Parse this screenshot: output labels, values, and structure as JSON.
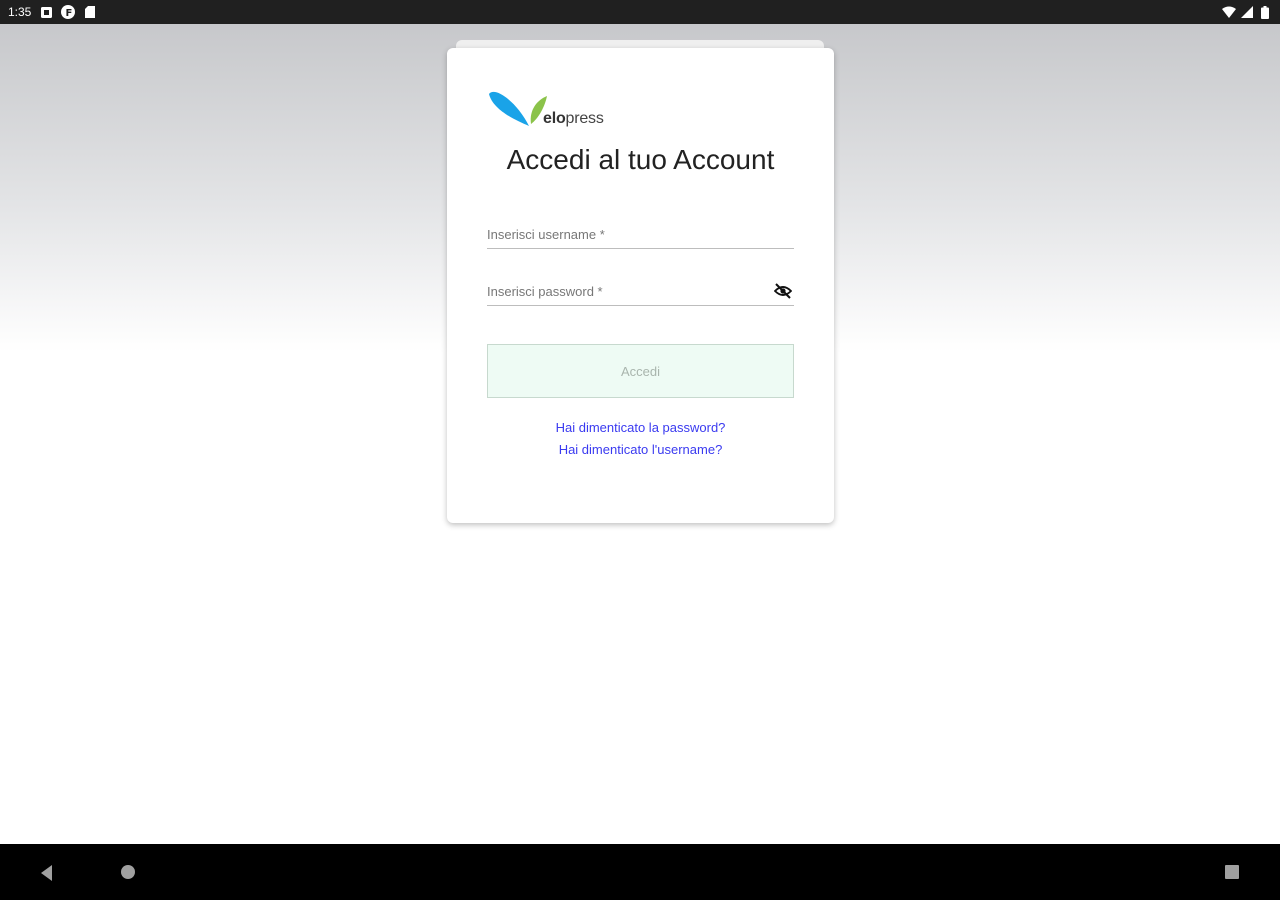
{
  "status_bar": {
    "time": "1:35",
    "icons_left": [
      "notification-icon",
      "app-icon",
      "sd-card-icon"
    ],
    "icons_right": [
      "wifi-icon",
      "signal-icon",
      "battery-icon"
    ]
  },
  "logo": {
    "brand_prefix": "V",
    "brand_bold": "elo",
    "brand_rest": "press",
    "colors": {
      "blue": "#1aa3e8",
      "green": "#8bc34a"
    }
  },
  "login": {
    "title": "Accedi al tuo Account",
    "username_placeholder": "Inserisci username *",
    "password_placeholder": "Inserisci password *",
    "submit_label": "Accedi",
    "forgot_password": "Hai dimenticato la password?",
    "forgot_username": "Hai dimenticato l'username?"
  },
  "colors": {
    "link": "#3a3af0",
    "button_bg": "#eefbf4",
    "nav_bar": "#000000",
    "status_bar": "#202020"
  }
}
